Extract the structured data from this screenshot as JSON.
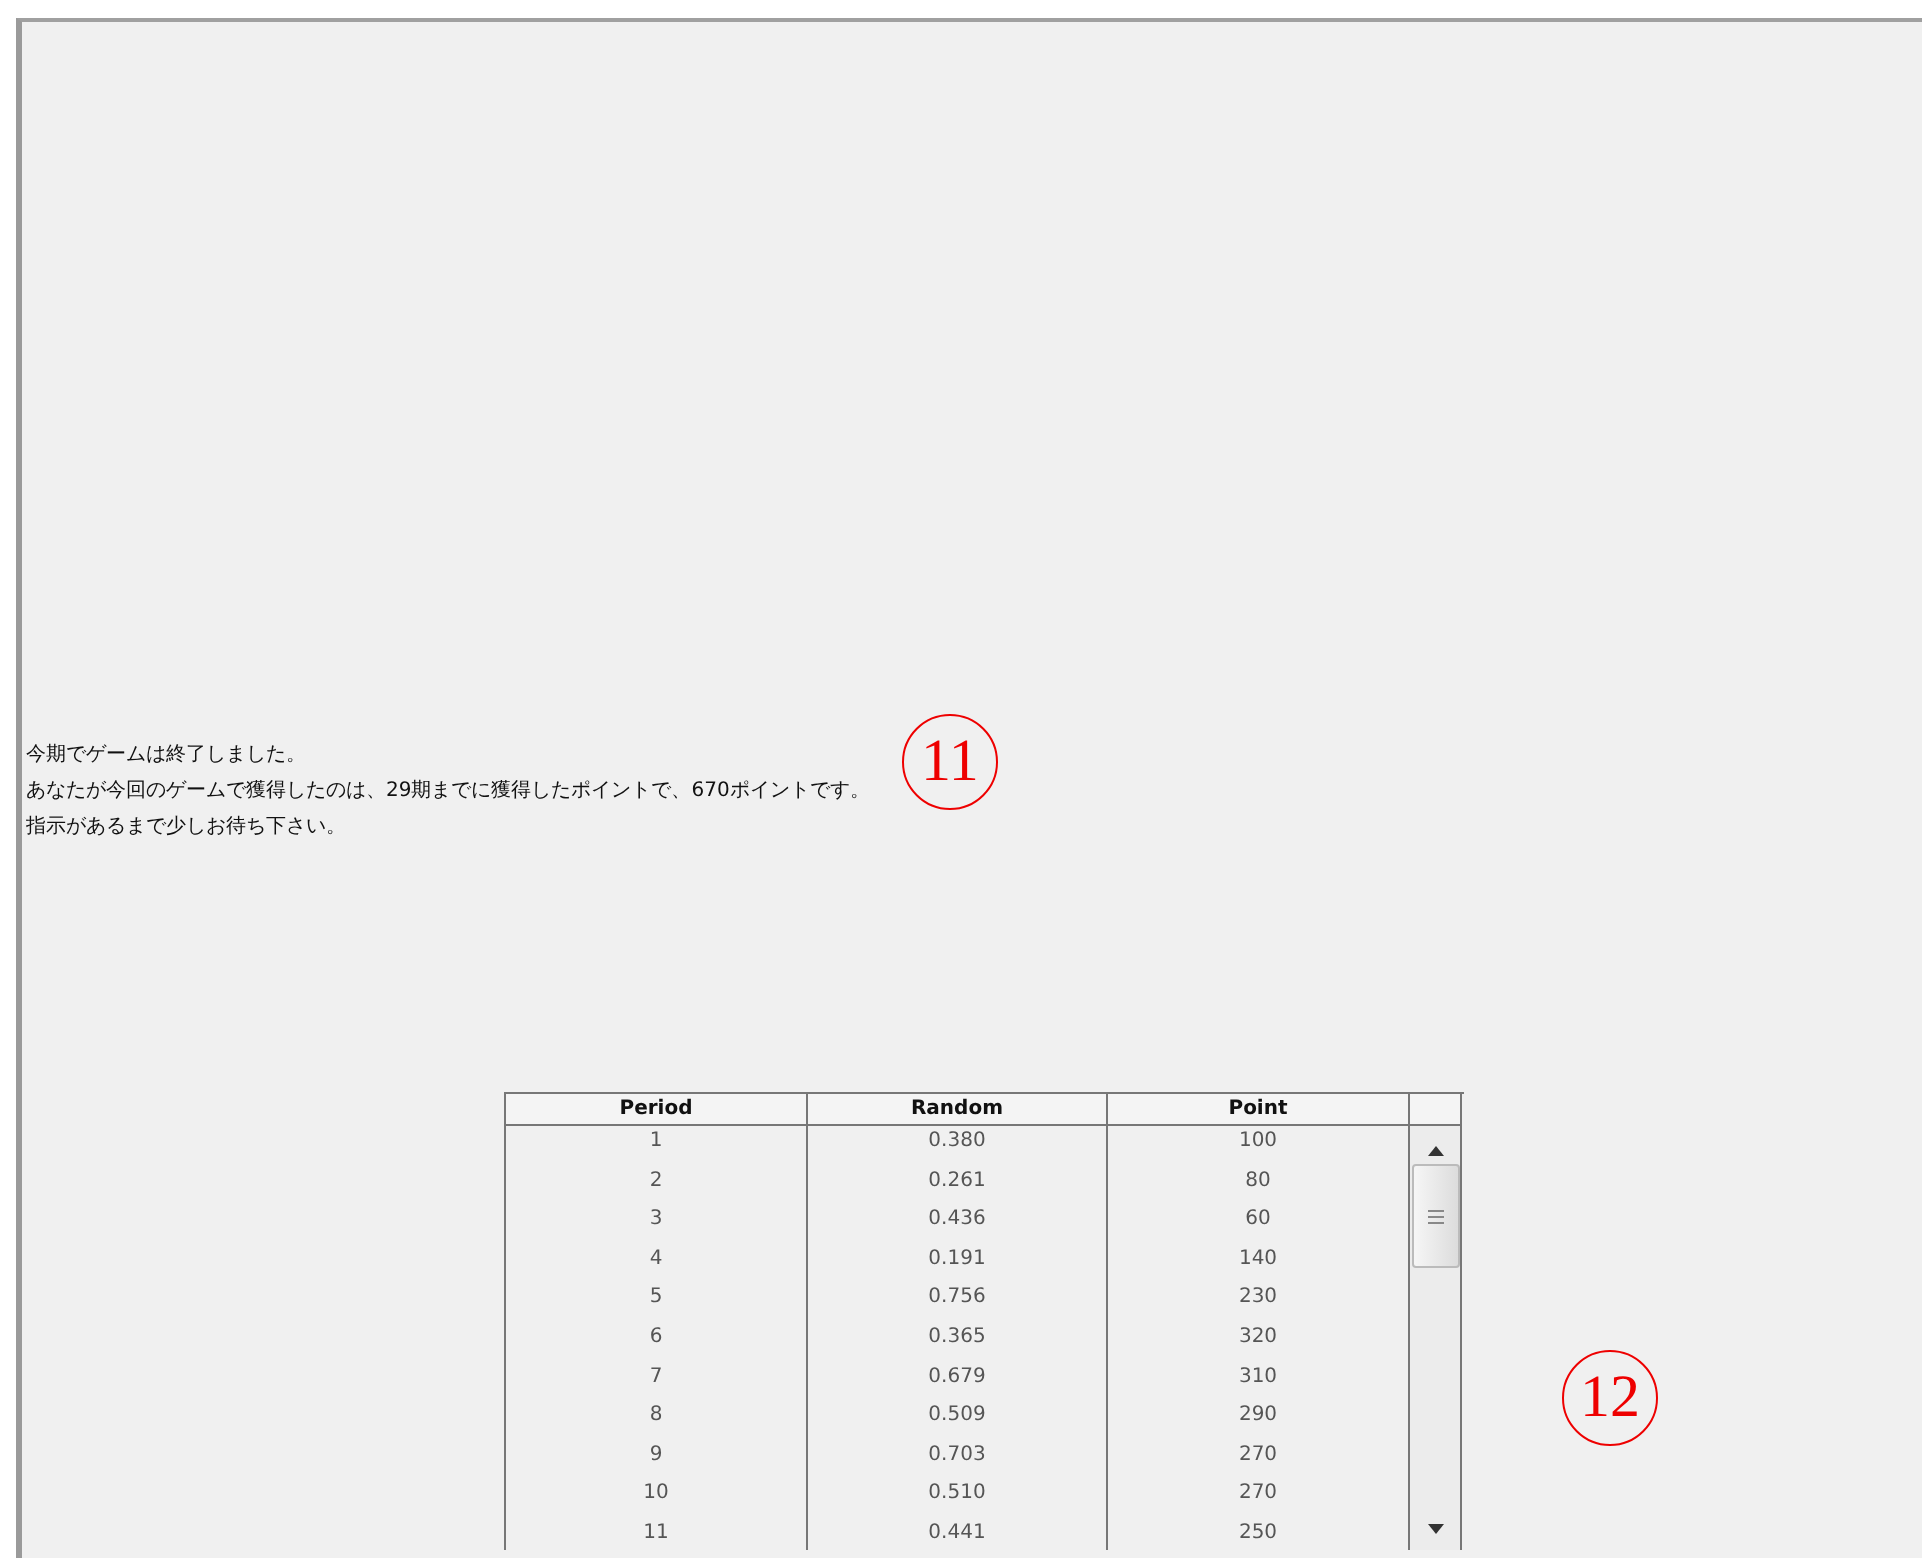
{
  "message": [
    "今期でゲームは終了しました。",
    "あなたが今回のゲームで獲得したのは、29期までに獲得したポイントで、670ポイントです。",
    "指示があるまで少しお待ち下さい。"
  ],
  "annotations": [
    "11",
    "12"
  ],
  "table": {
    "columns": [
      "Period",
      "Random",
      "Point"
    ],
    "rows": [
      [
        "1",
        "0.380",
        "100"
      ],
      [
        "2",
        "0.261",
        "80"
      ],
      [
        "3",
        "0.436",
        "60"
      ],
      [
        "4",
        "0.191",
        "140"
      ],
      [
        "5",
        "0.756",
        "230"
      ],
      [
        "6",
        "0.365",
        "320"
      ],
      [
        "7",
        "0.679",
        "310"
      ],
      [
        "8",
        "0.509",
        "290"
      ],
      [
        "9",
        "0.703",
        "270"
      ],
      [
        "10",
        "0.510",
        "270"
      ],
      [
        "11",
        "0.441",
        "250"
      ]
    ]
  }
}
